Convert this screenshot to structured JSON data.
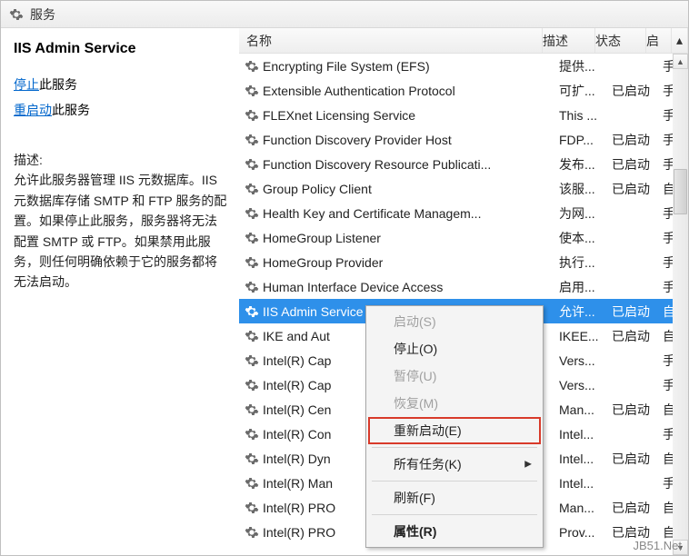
{
  "window": {
    "title": "服务"
  },
  "left": {
    "heading": "IIS Admin Service",
    "stop_link": "停止",
    "stop_suffix": "此服务",
    "restart_link": "重启动",
    "restart_suffix": "此服务",
    "desc_label": "描述:",
    "desc_body": "允许此服务器管理 IIS 元数据库。IIS 元数据库存储 SMTP 和 FTP 服务的配置。如果停止此服务，服务器将无法配置 SMTP 或 FTP。如果禁用此服务，则任何明确依赖于它的服务都将无法启动。"
  },
  "columns": {
    "name": "名称",
    "desc": "描述",
    "status": "状态",
    "startup": "启"
  },
  "services": [
    {
      "name": "Encrypting File System (EFS)",
      "desc": "提供...",
      "status": "",
      "startup": "手"
    },
    {
      "name": "Extensible Authentication Protocol",
      "desc": "可扩...",
      "status": "已启动",
      "startup": "手"
    },
    {
      "name": "FLEXnet Licensing Service",
      "desc": "This ...",
      "status": "",
      "startup": "手"
    },
    {
      "name": "Function Discovery Provider Host",
      "desc": "FDP...",
      "status": "已启动",
      "startup": "手"
    },
    {
      "name": "Function Discovery Resource Publicati...",
      "desc": "发布...",
      "status": "已启动",
      "startup": "手"
    },
    {
      "name": "Group Policy Client",
      "desc": "该服...",
      "status": "已启动",
      "startup": "自"
    },
    {
      "name": "Health Key and Certificate Managem...",
      "desc": "为网...",
      "status": "",
      "startup": "手"
    },
    {
      "name": "HomeGroup Listener",
      "desc": "使本...",
      "status": "",
      "startup": "手"
    },
    {
      "name": "HomeGroup Provider",
      "desc": "执行...",
      "status": "",
      "startup": "手"
    },
    {
      "name": "Human Interface Device Access",
      "desc": "启用...",
      "status": "",
      "startup": "手"
    },
    {
      "name": "IIS Admin Service",
      "desc": "允许...",
      "status": "已启动",
      "startup": "自",
      "selected": true
    },
    {
      "name": "IKE and Aut",
      "desc": "IKEE...",
      "status": "已启动",
      "startup": "自"
    },
    {
      "name": "Intel(R) Cap",
      "desc": "Vers...",
      "status": "",
      "startup": "手"
    },
    {
      "name": "Intel(R) Cap",
      "desc": "Vers...",
      "status": "",
      "startup": "手"
    },
    {
      "name": "Intel(R) Cen",
      "desc": "Man...",
      "status": "已启动",
      "startup": "自"
    },
    {
      "name": "Intel(R) Con",
      "desc": "Intel...",
      "status": "",
      "startup": "手"
    },
    {
      "name": "Intel(R) Dyn",
      "desc": "Intel...",
      "status": "已启动",
      "startup": "自"
    },
    {
      "name": "Intel(R) Man",
      "desc": "Intel...",
      "status": "",
      "startup": "手"
    },
    {
      "name": "Intel(R) PRO",
      "desc": "Man...",
      "status": "已启动",
      "startup": "自"
    },
    {
      "name": "Intel(R) PRO",
      "desc": "Prov...",
      "status": "已启动",
      "startup": "自"
    }
  ],
  "context_menu": {
    "items": [
      {
        "id": "start",
        "label": "启动(S)",
        "disabled": true
      },
      {
        "id": "stop",
        "label": "停止(O)"
      },
      {
        "id": "pause",
        "label": "暂停(U)",
        "disabled": true
      },
      {
        "id": "resume",
        "label": "恢复(M)",
        "disabled": true
      },
      {
        "id": "restart",
        "label": "重新启动(E)",
        "highlighted": true
      },
      {
        "sep": true
      },
      {
        "id": "alltasks",
        "label": "所有任务(K)",
        "submenu": true
      },
      {
        "sep": true
      },
      {
        "id": "refresh",
        "label": "刷新(F)"
      },
      {
        "sep": true
      },
      {
        "id": "props",
        "label": "属性(R)",
        "bold": true
      }
    ]
  },
  "watermark": "JB51.Net"
}
